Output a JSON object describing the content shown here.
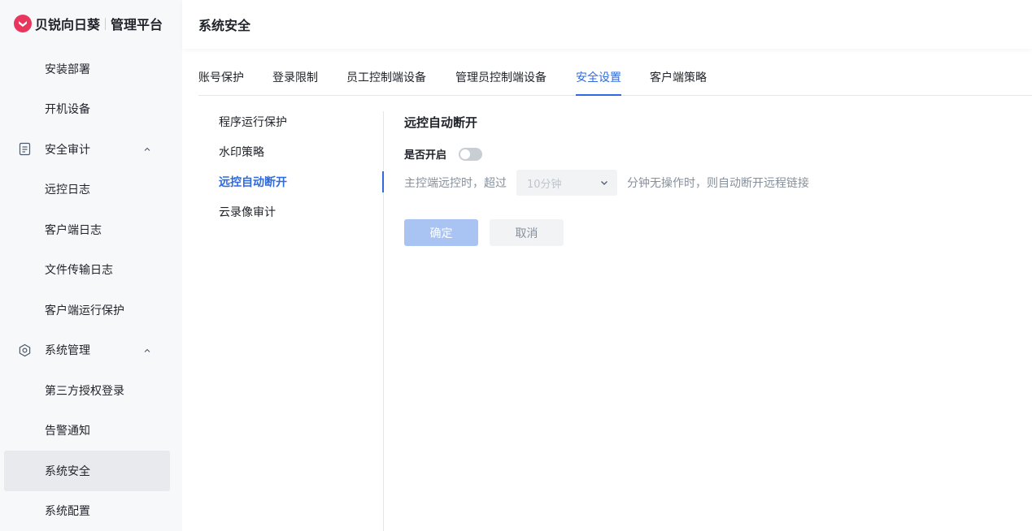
{
  "brand": {
    "name": "贝锐向日葵",
    "sub": "管理平台",
    "logo_color": "#e8365d"
  },
  "header": {
    "title": "系统安全"
  },
  "sidebar": {
    "items": [
      {
        "label": "安装部署"
      },
      {
        "label": "开机设备"
      },
      {
        "label": "安全审计",
        "group": true,
        "icon": "document-icon"
      },
      {
        "label": "远控日志"
      },
      {
        "label": "客户端日志"
      },
      {
        "label": "文件传输日志"
      },
      {
        "label": "客户端运行保护"
      },
      {
        "label": "系统管理",
        "group": true,
        "icon": "gear-icon"
      },
      {
        "label": "第三方授权登录"
      },
      {
        "label": "告警通知"
      },
      {
        "label": "系统安全",
        "active": true
      },
      {
        "label": "系统配置"
      }
    ]
  },
  "tabs": [
    {
      "label": "账号保护"
    },
    {
      "label": "登录限制"
    },
    {
      "label": "员工控制端设备"
    },
    {
      "label": "管理员控制端设备"
    },
    {
      "label": "安全设置",
      "active": true
    },
    {
      "label": "客户端策略"
    }
  ],
  "submenu": [
    {
      "label": "程序运行保护"
    },
    {
      "label": "水印策略"
    },
    {
      "label": "远控自动断开",
      "active": true
    },
    {
      "label": "云录像审计"
    }
  ],
  "content": {
    "title": "远控自动断开",
    "toggle_label": "是否开启",
    "toggle_on": false,
    "prefix_text": "主控端远控时，超过",
    "select_value": "10分钟",
    "suffix_text": "分钟无操作时，则自动断开远程链接",
    "confirm_label": "确定",
    "cancel_label": "取消"
  },
  "colors": {
    "accent": "#2f6bdf",
    "primary_disabled": "#a9c4f2"
  }
}
